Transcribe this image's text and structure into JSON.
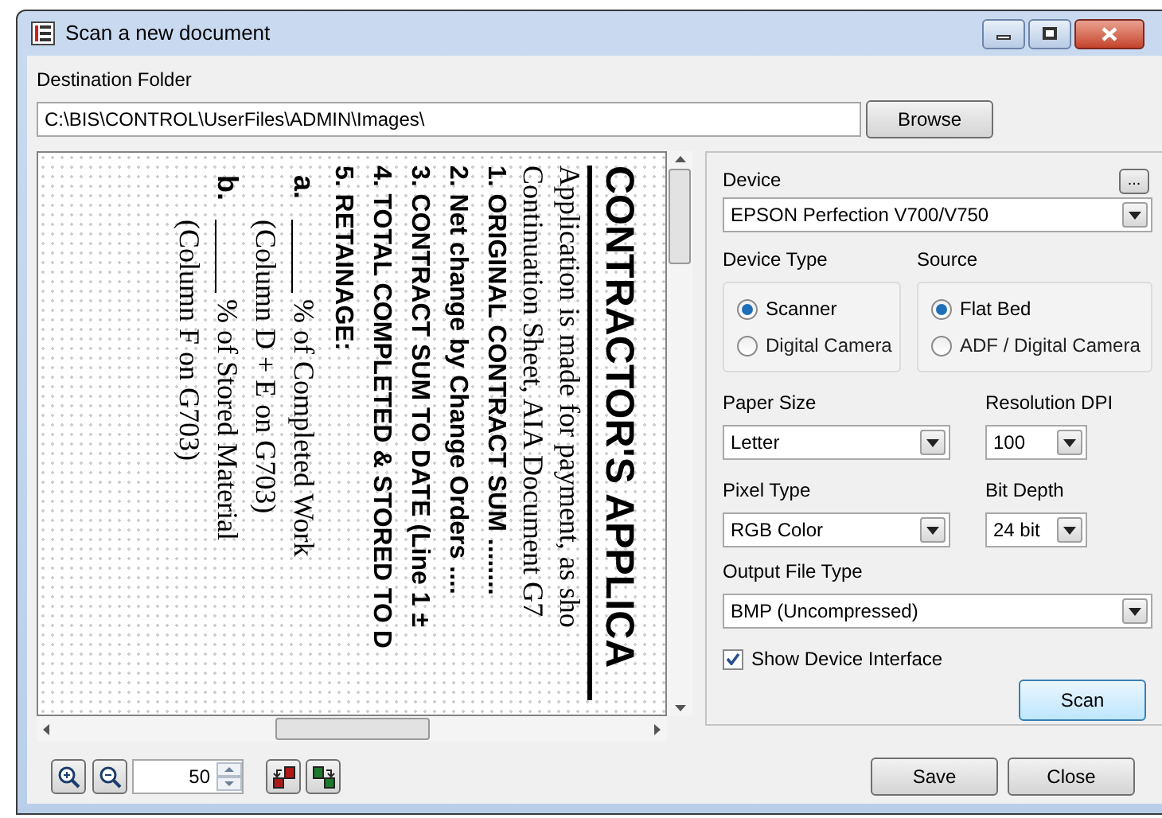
{
  "window": {
    "title": "Scan a new document"
  },
  "destination": {
    "label": "Destination Folder",
    "value": "C:\\BIS\\CONTROL\\UserFiles\\ADMIN\\Images\\",
    "browse_button": "Browse"
  },
  "preview": {
    "lines": [
      {
        "kind": "heading",
        "text": "CONTRACTOR'S APPLICA"
      },
      {
        "kind": "serif",
        "text": "Application is made for payment, as sho"
      },
      {
        "kind": "serif",
        "text": "Continuation Sheet, AIA Document G7"
      },
      {
        "kind": "item",
        "text": "1. ORIGINAL CONTRACT SUM ........"
      },
      {
        "kind": "item",
        "text": "2. Net change by Change Orders ...."
      },
      {
        "kind": "item",
        "text": "3. CONTRACT SUM TO DATE (Line 1 ±"
      },
      {
        "kind": "item",
        "text": "4. TOTAL COMPLETED & STORED TO D"
      },
      {
        "kind": "item",
        "text": "5. RETAINAGE:"
      },
      {
        "kind": "blank",
        "letter": "a.",
        "text": "% of Completed Work"
      },
      {
        "kind": "note",
        "text": "(Column D + E on G703)"
      },
      {
        "kind": "blank",
        "letter": "b.",
        "text": "% of Stored Material"
      },
      {
        "kind": "note",
        "text": "(Column F on G703)"
      }
    ]
  },
  "settings": {
    "device": {
      "label": "Device",
      "more_button": "...",
      "value": "EPSON Perfection V700/V750"
    },
    "device_type": {
      "label": "Device Type",
      "options": [
        {
          "label": "Scanner",
          "selected": true
        },
        {
          "label": "Digital Camera",
          "selected": false
        }
      ]
    },
    "source": {
      "label": "Source",
      "options": [
        {
          "label": "Flat Bed",
          "selected": true
        },
        {
          "label": "ADF / Digital Camera",
          "selected": false
        }
      ]
    },
    "paper_size": {
      "label": "Paper Size",
      "value": "Letter"
    },
    "resolution": {
      "label": "Resolution DPI",
      "value": "100"
    },
    "pixel_type": {
      "label": "Pixel Type",
      "value": "RGB Color"
    },
    "bit_depth": {
      "label": "Bit Depth",
      "value": "24 bit"
    },
    "output_file_type": {
      "label": "Output File Type",
      "value": "BMP (Uncompressed)"
    },
    "show_device_interface": {
      "label": "Show Device Interface",
      "checked": true
    },
    "scan_button": "Scan"
  },
  "zoom": {
    "value": "50"
  },
  "buttons": [
    "Save",
    "Close"
  ]
}
